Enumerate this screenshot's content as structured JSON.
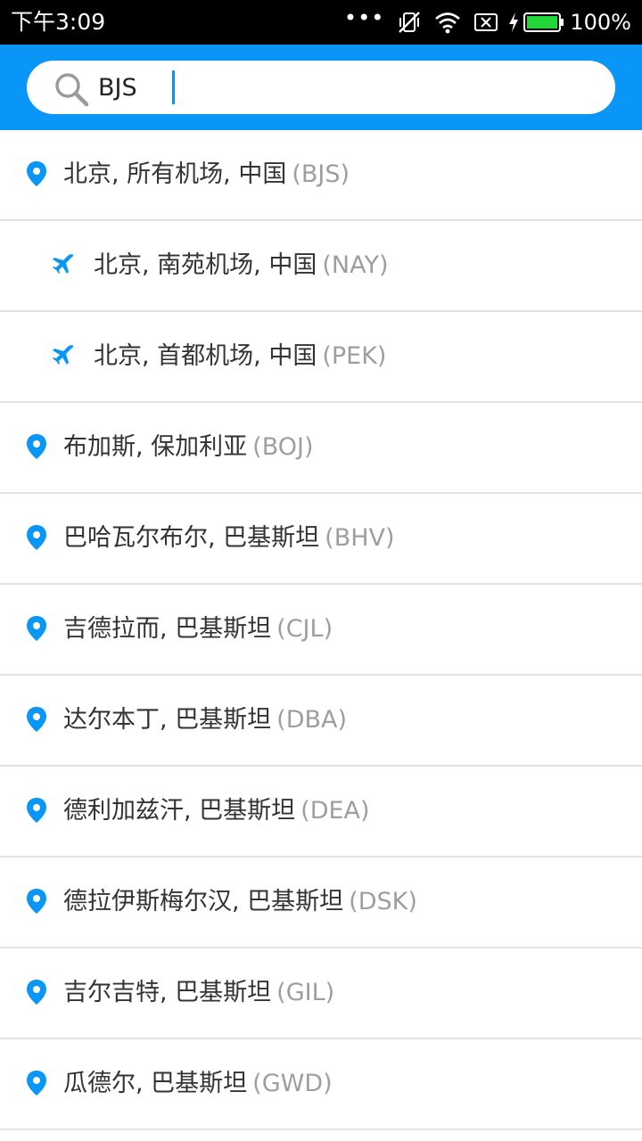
{
  "status_bar": {
    "time": "下午3:09",
    "battery": "100%",
    "battery_color": "#22d63a"
  },
  "search": {
    "value": "BJS",
    "accent_color": "#0a96f6"
  },
  "results": [
    {
      "type": "city",
      "icon": "location-pin-icon",
      "name": "北京, 所有机场, 中国",
      "code": "(BJS)"
    },
    {
      "type": "airport",
      "icon": "airplane-icon",
      "name": "北京, 南苑机场, 中国",
      "code": "(NAY)"
    },
    {
      "type": "airport",
      "icon": "airplane-icon",
      "name": "北京, 首都机场, 中国",
      "code": "(PEK)"
    },
    {
      "type": "city",
      "icon": "location-pin-icon",
      "name": "布加斯, 保加利亚",
      "code": "(BOJ)"
    },
    {
      "type": "city",
      "icon": "location-pin-icon",
      "name": "巴哈瓦尔布尔, 巴基斯坦",
      "code": "(BHV)"
    },
    {
      "type": "city",
      "icon": "location-pin-icon",
      "name": "吉德拉而, 巴基斯坦",
      "code": "(CJL)"
    },
    {
      "type": "city",
      "icon": "location-pin-icon",
      "name": "达尔本丁, 巴基斯坦",
      "code": "(DBA)"
    },
    {
      "type": "city",
      "icon": "location-pin-icon",
      "name": "德利加兹汗, 巴基斯坦",
      "code": "(DEA)"
    },
    {
      "type": "city",
      "icon": "location-pin-icon",
      "name": "德拉伊斯梅尔汉, 巴基斯坦",
      "code": "(DSK)"
    },
    {
      "type": "city",
      "icon": "location-pin-icon",
      "name": "吉尔吉特, 巴基斯坦",
      "code": "(GIL)"
    },
    {
      "type": "city",
      "icon": "location-pin-icon",
      "name": "瓜德尔, 巴基斯坦",
      "code": "(GWD)"
    }
  ]
}
